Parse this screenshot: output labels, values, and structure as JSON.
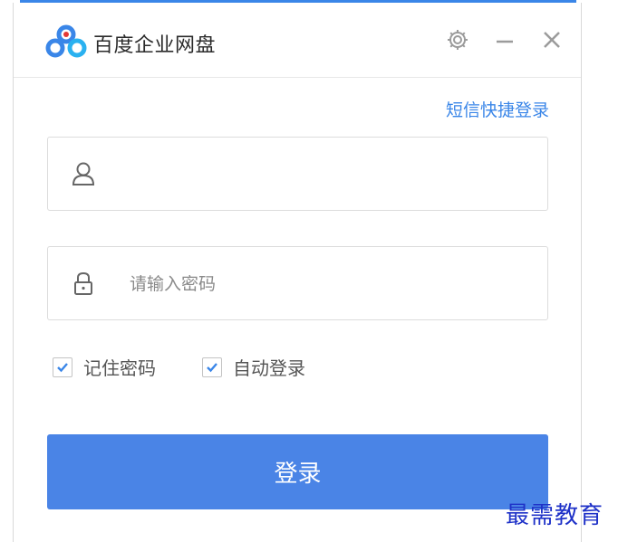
{
  "app": {
    "title": "百度企业网盘"
  },
  "titlebar": {
    "settings_icon": "gear-icon",
    "minimize_icon": "minimize-icon",
    "close_icon": "close-icon"
  },
  "login": {
    "sms_link": "短信快捷登录",
    "username": {
      "value": "",
      "placeholder": "",
      "icon": "user-icon"
    },
    "password": {
      "value": "",
      "placeholder": "请输入密码",
      "icon": "lock-icon"
    },
    "remember_password": {
      "label": "记住密码",
      "checked": true
    },
    "auto_login": {
      "label": "自动登录",
      "checked": true
    },
    "submit_label": "登录"
  },
  "watermark": "最需教育",
  "colors": {
    "accent": "#3a86e8",
    "button": "#4a84e6",
    "watermark": "#1f32c8"
  }
}
